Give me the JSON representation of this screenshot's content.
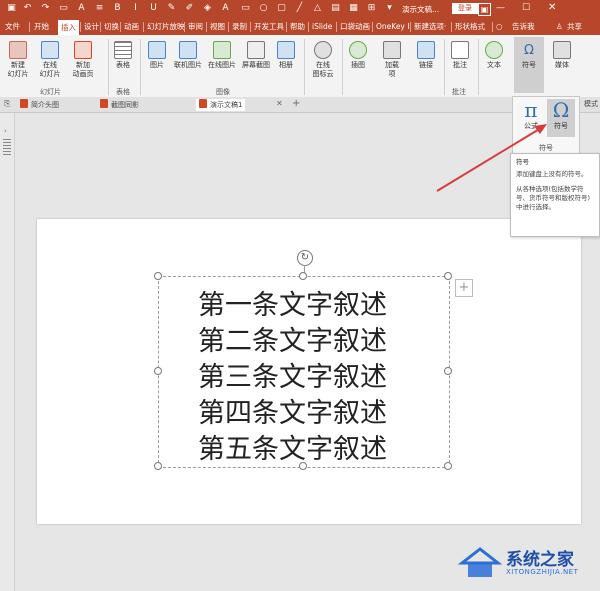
{
  "titlebar": {
    "doc_title": "演示文稿...",
    "login": "登录",
    "extra_tab": "形状格式"
  },
  "tabs": [
    "文件",
    "开始",
    "插入",
    "设计",
    "切换",
    "动画",
    "幻灯片放映",
    "审阅",
    "视图",
    "录制",
    "开发工具",
    "帮助",
    "iSlide",
    "口袋动画",
    "OneKey I",
    "新建选项·",
    "形状格式",
    "告诉我",
    "共享"
  ],
  "ribbon": {
    "slides_group": {
      "label": "幻灯片",
      "new_slide": "新建\n幻灯片",
      "online_slide": "在线\n幻灯片",
      "add_anim_page": "新加\n动画页"
    },
    "tables_group": {
      "label": "表格",
      "table": "表格"
    },
    "images_group": {
      "label": "图像",
      "picture": "图片",
      "online_picture": "联机图片",
      "online_pic2": "在线图片",
      "screenshot": "屏幕截图",
      "album": "相册"
    },
    "icons_group": {
      "online_icons": "在线\n图标云"
    },
    "illustration": "插图",
    "addins": "加载\n项",
    "link": "链接",
    "comment": "批注",
    "comments_group": {
      "label": "批注"
    },
    "text": "文本",
    "symbols": "符号",
    "media": "媒体",
    "mode": "模式"
  },
  "doc_tabs": [
    "简介头图",
    "截图同影",
    "演示文稿1"
  ],
  "slide_text": {
    "lines": [
      "第一条文字叙述",
      "第二条文字叙述",
      "第三条文字叙述",
      "第四条文字叙述",
      "第五条文字叙述"
    ]
  },
  "symbols_popup": {
    "equation_label": "公式",
    "symbol_label": "符号",
    "group_label": "符号",
    "equation_glyph": "π",
    "symbol_glyph": "Ω"
  },
  "tooltip": {
    "title": "符号",
    "line1": "添加键盘上没有的符号。",
    "line2": "从各种选项(包括数学符号、货币符号和版权符号)中进行选择。"
  },
  "watermark": {
    "name": "系统之家",
    "url": "XITONGZHIJIA.NET"
  },
  "colors": {
    "brand": "#b7472a",
    "arrow": "#d83b3b",
    "watermark": "#2a6fd6"
  }
}
